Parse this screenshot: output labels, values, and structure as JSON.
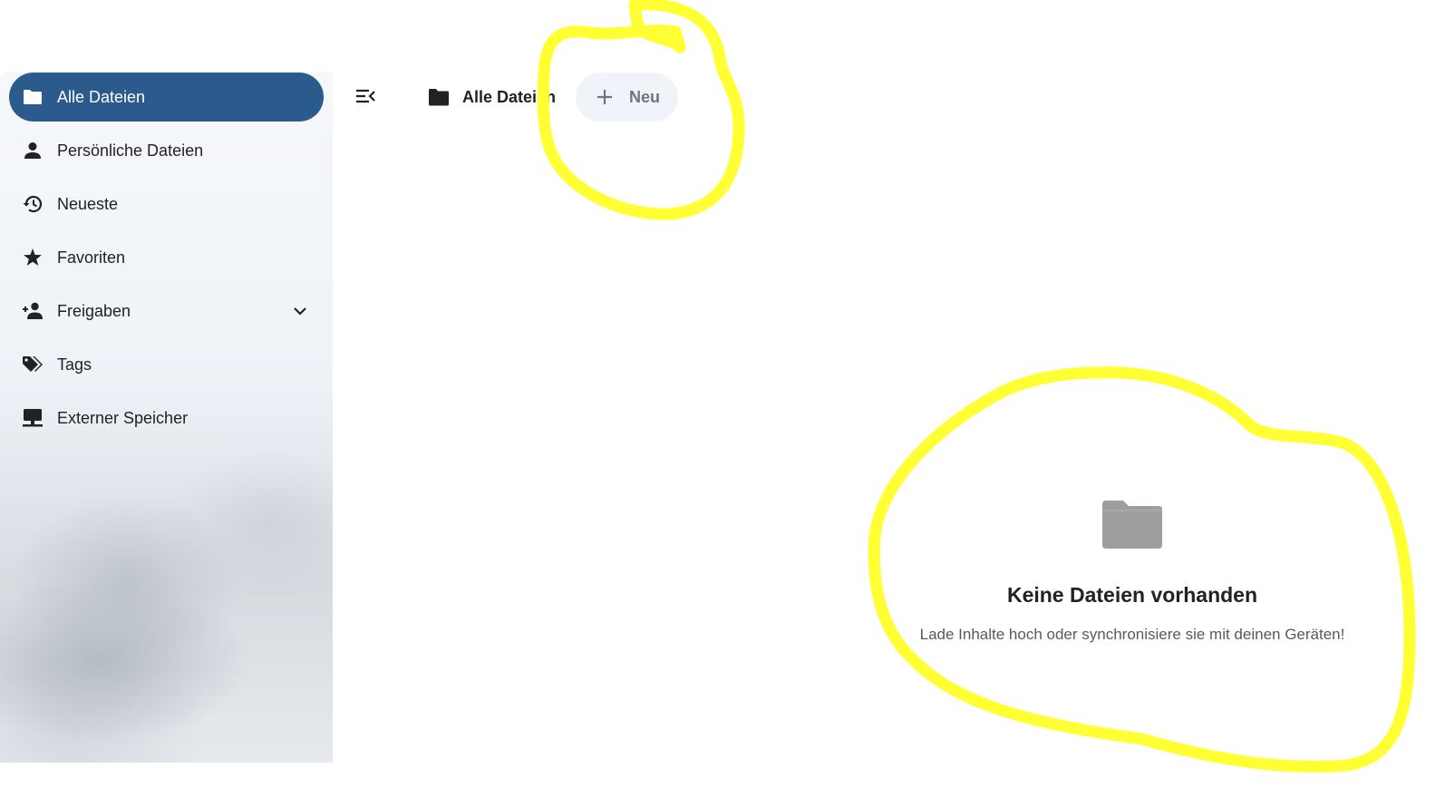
{
  "sidebar": {
    "items": [
      {
        "label": "Alle Dateien",
        "icon": "folder-icon",
        "active": true
      },
      {
        "label": "Persönliche Dateien",
        "icon": "person-icon"
      },
      {
        "label": "Neueste",
        "icon": "history-icon"
      },
      {
        "label": "Favoriten",
        "icon": "star-icon"
      },
      {
        "label": "Freigaben",
        "icon": "share-person-icon",
        "expandable": true
      },
      {
        "label": "Tags",
        "icon": "tag-icon"
      },
      {
        "label": "Externer Speicher",
        "icon": "external-storage-icon"
      }
    ]
  },
  "header": {
    "breadcrumb_label": "Alle Dateien",
    "new_button_label": "Neu"
  },
  "empty_state": {
    "title": "Keine Dateien vorhanden",
    "description": "Lade Inhalte hoch oder synchronisiere sie mit deinen Geräten!"
  },
  "colors": {
    "accent": "#2b5a8c",
    "annotation": "#ffff33",
    "empty_icon": "#9e9e9e"
  }
}
